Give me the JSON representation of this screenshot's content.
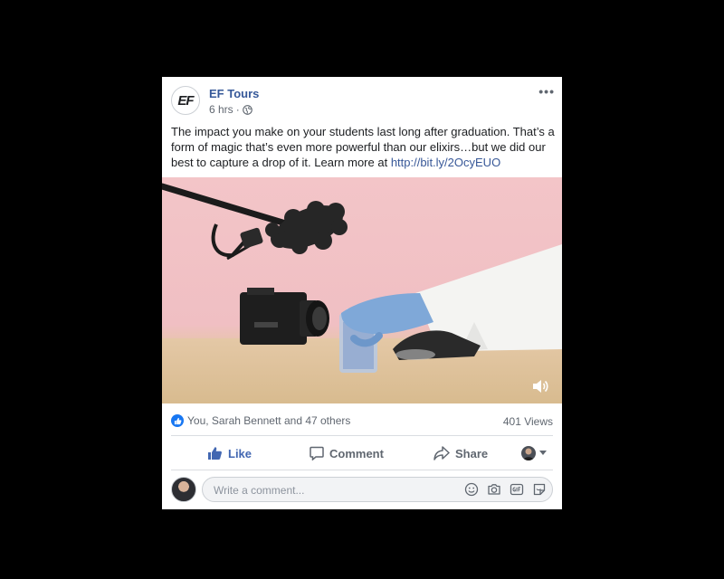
{
  "post": {
    "page_name": "EF Tours",
    "page_logo_text": "EF",
    "time": "6 hrs",
    "dot": "·",
    "more_label": "•••",
    "text_before_link": "The impact you make on your students last long after graduation. That’s a form of magic that’s even more powerful than our elixirs…but we did our best to capture a drop of it. Learn more at ",
    "link_text": "http://bit.ly/2OcyEUO"
  },
  "media": {
    "volume_icon": "speaker-icon"
  },
  "stats": {
    "reactions_text": "You, Sarah Bennett and 47 others",
    "views_text": "401 Views"
  },
  "actions": {
    "like_label": "Like",
    "comment_label": "Comment",
    "share_label": "Share"
  },
  "comment": {
    "placeholder": "Write a comment..."
  },
  "colors": {
    "link": "#385898",
    "accent": "#4267b2",
    "secondary_text": "#606770"
  }
}
